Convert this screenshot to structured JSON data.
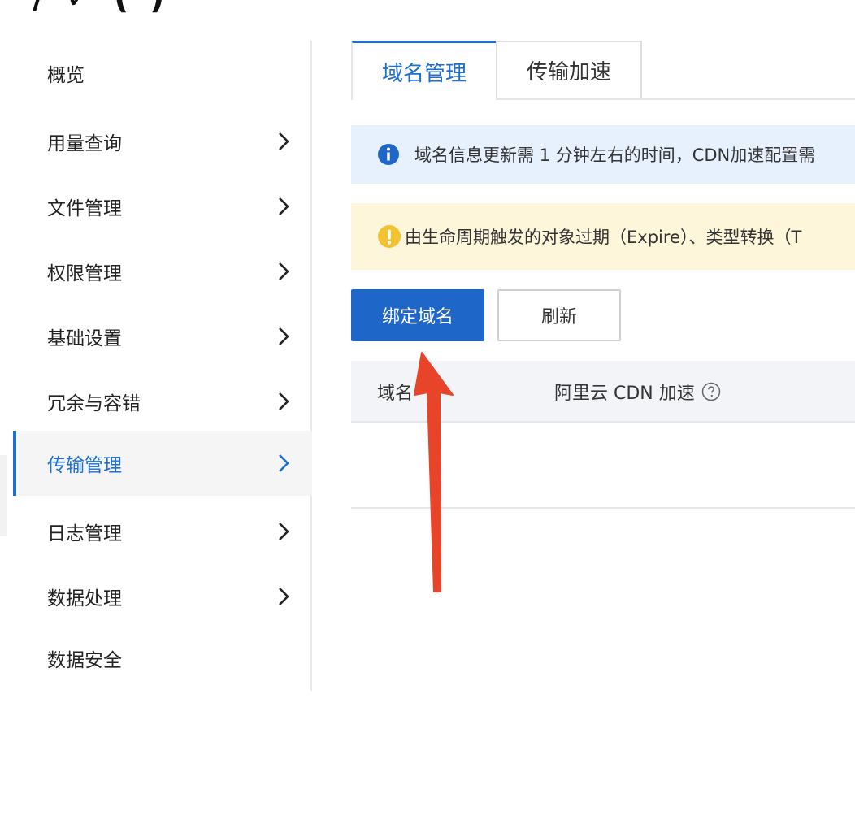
{
  "page": {
    "top_title_fragment": "/ ✓ (   )"
  },
  "sidebar": {
    "items": [
      {
        "label": "概览",
        "has_chevron": false
      },
      {
        "label": "用量查询",
        "has_chevron": true
      },
      {
        "label": "文件管理",
        "has_chevron": true
      },
      {
        "label": "权限管理",
        "has_chevron": true
      },
      {
        "label": "基础设置",
        "has_chevron": true
      },
      {
        "label": "冗余与容错",
        "has_chevron": true
      },
      {
        "label": "传输管理",
        "has_chevron": true,
        "active": true
      },
      {
        "label": "日志管理",
        "has_chevron": true
      },
      {
        "label": "数据处理",
        "has_chevron": true
      },
      {
        "label": "数据安全",
        "has_chevron": false
      }
    ],
    "chevron_icon": "chevron-right-icon"
  },
  "tabs": [
    {
      "label": "域名管理",
      "active": true
    },
    {
      "label": "传输加速",
      "active": false
    }
  ],
  "alerts": {
    "info": {
      "icon": "info-circle-icon",
      "text": "域名信息更新需 1 分钟左右的时间，CDN加速配置需"
    },
    "warning": {
      "icon": "exclamation-circle-icon",
      "text": "由生命周期触发的对象过期（Expire）、类型转换（T"
    }
  },
  "toolbar": {
    "bind_domain_label": "绑定域名",
    "refresh_label": "刷新"
  },
  "table": {
    "columns": [
      "域名",
      "阿里云 CDN 加速"
    ],
    "help_icon": "question-circle-icon",
    "rows": []
  },
  "colors": {
    "accent": "#1e6fd0",
    "primary_button": "#1e66c8",
    "info_bg": "#e7f1fd",
    "warning_bg": "#fdf6db",
    "warning_icon": "#f2c230",
    "annotation_arrow": "#e8442a"
  }
}
